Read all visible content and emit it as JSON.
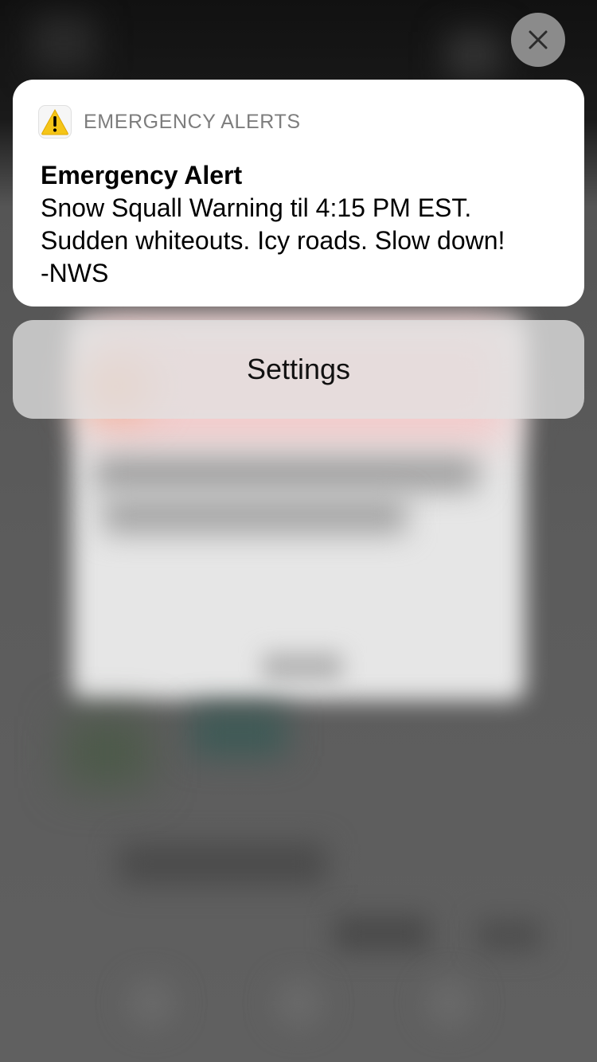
{
  "notification": {
    "app_name": "EMERGENCY ALERTS",
    "app_icon": "warning-triangle-icon",
    "title": "Emergency Alert",
    "body_lines": [
      "Snow Squall Warning til 4:15 PM EST.",
      "Sudden whiteouts. Icy roads. Slow down!",
      "-NWS"
    ]
  },
  "actions": {
    "settings_label": "Settings"
  },
  "controls": {
    "close_icon": "close-icon"
  },
  "colors": {
    "warning_yellow": "#F5C518",
    "card_background": "#FFFFFF",
    "secondary_text": "#7D7D7D"
  }
}
